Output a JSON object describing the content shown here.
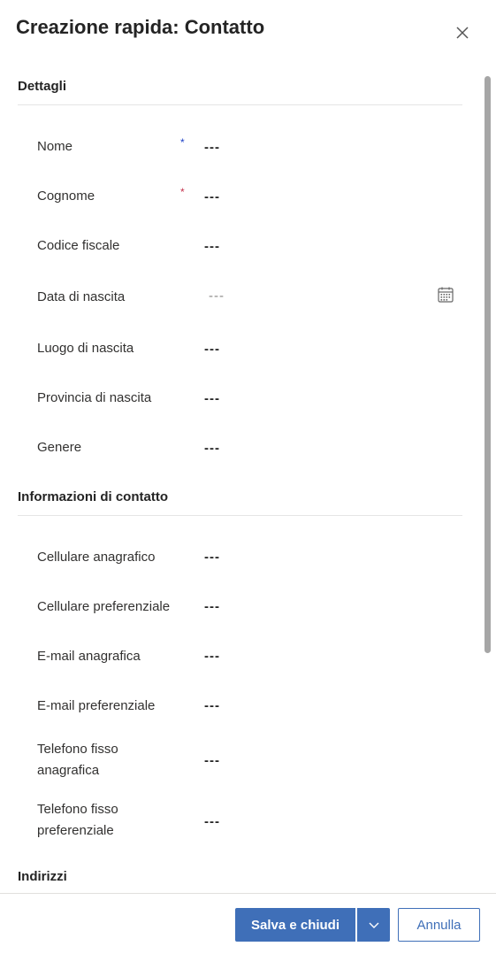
{
  "header": {
    "title": "Creazione rapida: Contatto"
  },
  "sections": {
    "dettagli": {
      "title": "Dettagli",
      "fields": {
        "nome": {
          "label": "Nome",
          "value": "---",
          "required": "*"
        },
        "cognome": {
          "label": "Cognome",
          "value": "---",
          "required": "*"
        },
        "codice_fiscale": {
          "label": "Codice fiscale",
          "value": "---"
        },
        "data_nascita": {
          "label": "Data di nascita",
          "value": "---"
        },
        "luogo_nascita": {
          "label": "Luogo di nascita",
          "value": "---"
        },
        "provincia_nascita": {
          "label": "Provincia di nascita",
          "value": "---"
        },
        "genere": {
          "label": "Genere",
          "value": "---"
        }
      }
    },
    "contatto": {
      "title": "Informazioni di contatto",
      "fields": {
        "cell_anagrafico": {
          "label": "Cellulare anagrafico",
          "value": "---"
        },
        "cell_preferenziale": {
          "label": "Cellulare preferenziale",
          "value": "---"
        },
        "email_anagrafica": {
          "label": "E-mail anagrafica",
          "value": "---"
        },
        "email_preferenziale": {
          "label": "E-mail preferenziale",
          "value": "---"
        },
        "tel_fisso_anagrafica": {
          "label_line1": "Telefono fisso",
          "label_line2": "anagrafica",
          "value": "---"
        },
        "tel_fisso_preferenziale": {
          "label_line1": "Telefono fisso",
          "label_line2": "preferenziale",
          "value": "---"
        }
      }
    },
    "indirizzi": {
      "title": "Indirizzi"
    }
  },
  "footer": {
    "save_label": "Salva e chiudi",
    "cancel_label": "Annulla"
  },
  "colors": {
    "primary": "#3f6fb8",
    "required_red": "#c4314b",
    "required_blue": "#1b3fc6"
  },
  "icons": {
    "close": "close-icon",
    "calendar": "calendar-icon",
    "chevron": "chevron-down-icon"
  }
}
